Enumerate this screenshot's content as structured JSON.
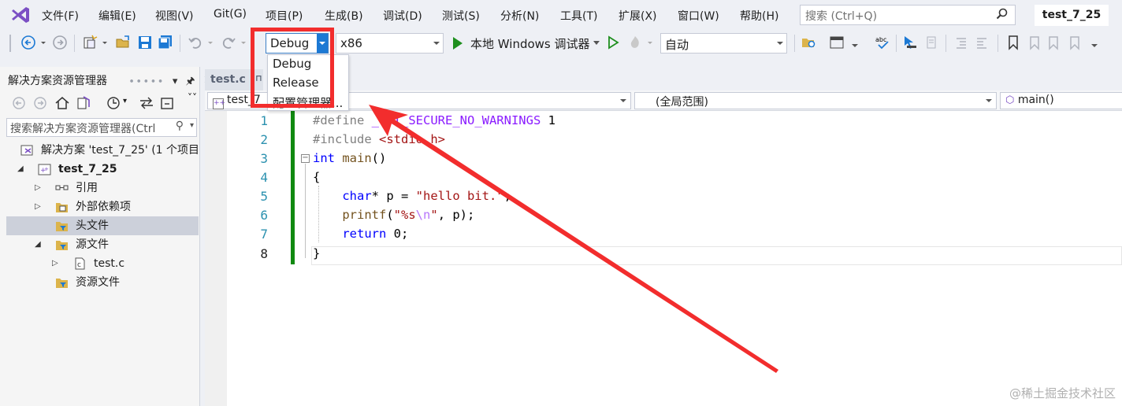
{
  "menubar": {
    "items": [
      "文件(F)",
      "编辑(E)",
      "视图(V)",
      "Git(G)",
      "项目(P)",
      "生成(B)",
      "调试(D)",
      "测试(S)",
      "分析(N)",
      "工具(T)",
      "扩展(X)",
      "窗口(W)",
      "帮助(H)"
    ],
    "search_placeholder": "搜索 (Ctrl+Q)",
    "solution_name": "test_7_25"
  },
  "toolbar": {
    "config": "Debug",
    "platform": "x86",
    "run_label": "本地 Windows 调试器",
    "auto": "自动"
  },
  "config_menu": {
    "options": [
      "Debug",
      "Release",
      "配置管理器..."
    ]
  },
  "solution_explorer": {
    "title": "解决方案资源管理器",
    "search_placeholder": "搜索解决方案资源管理器(Ctrl",
    "tree": [
      {
        "label": "解决方案 'test_7_25' (1 个项目"
      },
      {
        "label": "test_7_25"
      },
      {
        "label": "引用"
      },
      {
        "label": "外部依赖项"
      },
      {
        "label": "头文件"
      },
      {
        "label": "源文件"
      },
      {
        "label": "test.c"
      },
      {
        "label": "资源文件"
      }
    ]
  },
  "editor": {
    "tab": "test.c",
    "nav_project": "test_7",
    "nav_scope": "(全局范围)",
    "nav_member": "main()",
    "line_numbers": [
      "1",
      "2",
      "3",
      "4",
      "5",
      "6",
      "7",
      "8"
    ]
  },
  "watermark": "@稀土掘金技术社区",
  "colors": {
    "highlight": "#f22d2d",
    "change_bar": "#108a10",
    "accent": "#1c79d4"
  }
}
